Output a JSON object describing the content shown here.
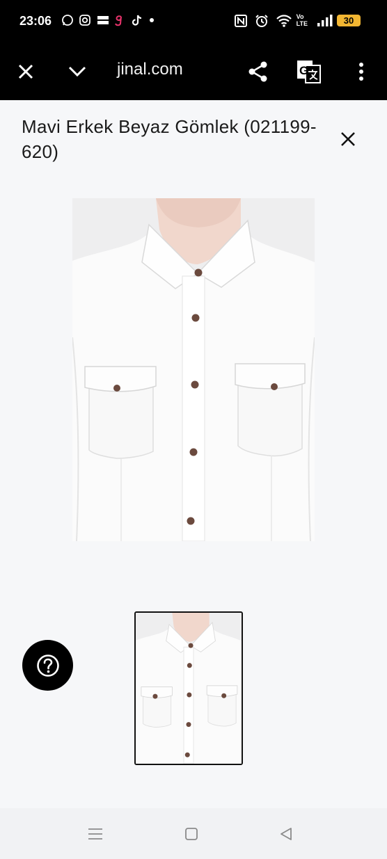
{
  "status_bar": {
    "time": "23:06",
    "left_icons": [
      "whatsapp-icon",
      "instagram-icon",
      "temu-icon",
      "g-app-icon",
      "tiktok-icon",
      "dot-icon"
    ],
    "right_icons": [
      "nfc-icon",
      "alarm-icon",
      "wifi-icon",
      "volte-icon",
      "signal-icon"
    ],
    "volte_label_top": "Vo",
    "volte_label_bottom": "LTE",
    "battery": "30"
  },
  "toolbar": {
    "url": "jinal.com",
    "icons": [
      "close-icon",
      "chevron-down-icon",
      "share-icon",
      "translate-icon",
      "more-vert-icon"
    ]
  },
  "page": {
    "title": "Mavi Erkek Beyaz Gömlek (021199-620)",
    "close_icon": "close-icon"
  },
  "gallery": {
    "main_image": "white-shirt-photo",
    "thumbnails": [
      "white-shirt-thumbnail"
    ],
    "selected_thumbnail": 0
  },
  "help": {
    "icon": "help-circle-icon"
  },
  "nav_bar": {
    "icons": [
      "menu-icon",
      "home-square-icon",
      "back-triangle-icon"
    ]
  },
  "colors": {
    "bar_background": "#000000",
    "page_background": "#f6f7f9",
    "battery": "#f2b632",
    "shirt": "#fbfbfb",
    "buttons": "#6b4a3e"
  }
}
